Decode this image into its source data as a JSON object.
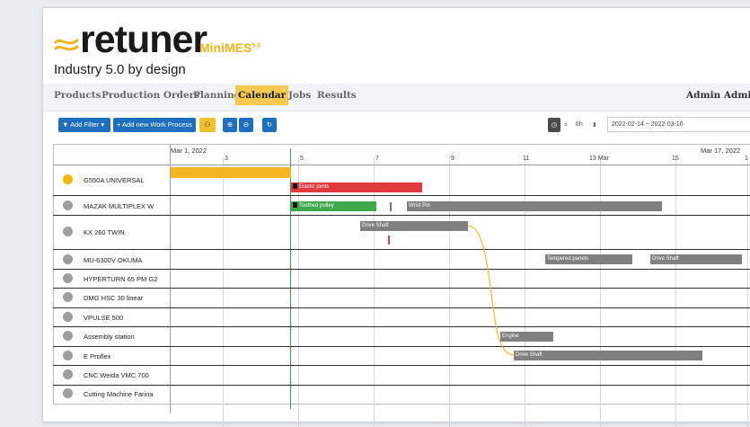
{
  "brand": {
    "name": "retuner",
    "product": "MiniMES",
    "product_version": "5.0",
    "tagline": "Industry 5.0 by design",
    "accent": "#f2b418"
  },
  "nav": {
    "items": [
      "Products",
      "Production Orders",
      "Planning",
      "Calendar",
      "Jobs",
      "Results"
    ],
    "active": "Calendar",
    "user": "Admin Admin"
  },
  "toolbar": {
    "add_filter": "Add Filter",
    "add_work_process": "+ Add new Work Process",
    "step_sign": "±",
    "step": "6h",
    "date_range": "2022-02-14 ~ 2022-03-16"
  },
  "timeline": {
    "start_date": "Mar 1, 2022",
    "end_date": "Mar 17, 2022",
    "ticks": [
      "3",
      "5",
      "7",
      "9",
      "11",
      "13 Mar",
      "15",
      "1"
    ]
  },
  "machines": [
    {
      "name": "G550A UNIVERSAL",
      "status": "active"
    },
    {
      "name": "MAZAK MULTIPLEX W",
      "status": "idle"
    },
    {
      "name": "KX 260 TWIN",
      "status": "idle"
    },
    {
      "name": "MU-6300V OKUMA",
      "status": "idle"
    },
    {
      "name": "HYPERTURN 65 PM G2",
      "status": "idle"
    },
    {
      "name": "DMG HSC 30 linear",
      "status": "idle"
    },
    {
      "name": "VPULSE 500",
      "status": "idle"
    },
    {
      "name": "Assembly station",
      "status": "idle"
    },
    {
      "name": "E Proflex",
      "status": "idle"
    },
    {
      "name": "CNC Weida VMC 700",
      "status": "idle"
    },
    {
      "name": "Cutting Machine Farina",
      "status": "idle"
    }
  ],
  "tasks": [
    {
      "label": "",
      "color": "yellow"
    },
    {
      "label": "Elastic joints",
      "color": "red",
      "locked": true
    },
    {
      "label": "Toothed pulley",
      "color": "green",
      "locked": true
    },
    {
      "label": "Wrist Pin",
      "color": "gray"
    },
    {
      "label": "Drive Shaft",
      "color": "gray"
    },
    {
      "label": "Tempered panels",
      "color": "gray"
    },
    {
      "label": "Drive Shaft",
      "color": "gray"
    },
    {
      "label": "Engine",
      "color": "gray"
    },
    {
      "label": "Drive Shaft",
      "color": "gray"
    }
  ],
  "colors": {
    "primary": "#1f6fbf",
    "highlight": "#f2c12e",
    "today": "#43a047",
    "dependency": "#f4b824"
  }
}
